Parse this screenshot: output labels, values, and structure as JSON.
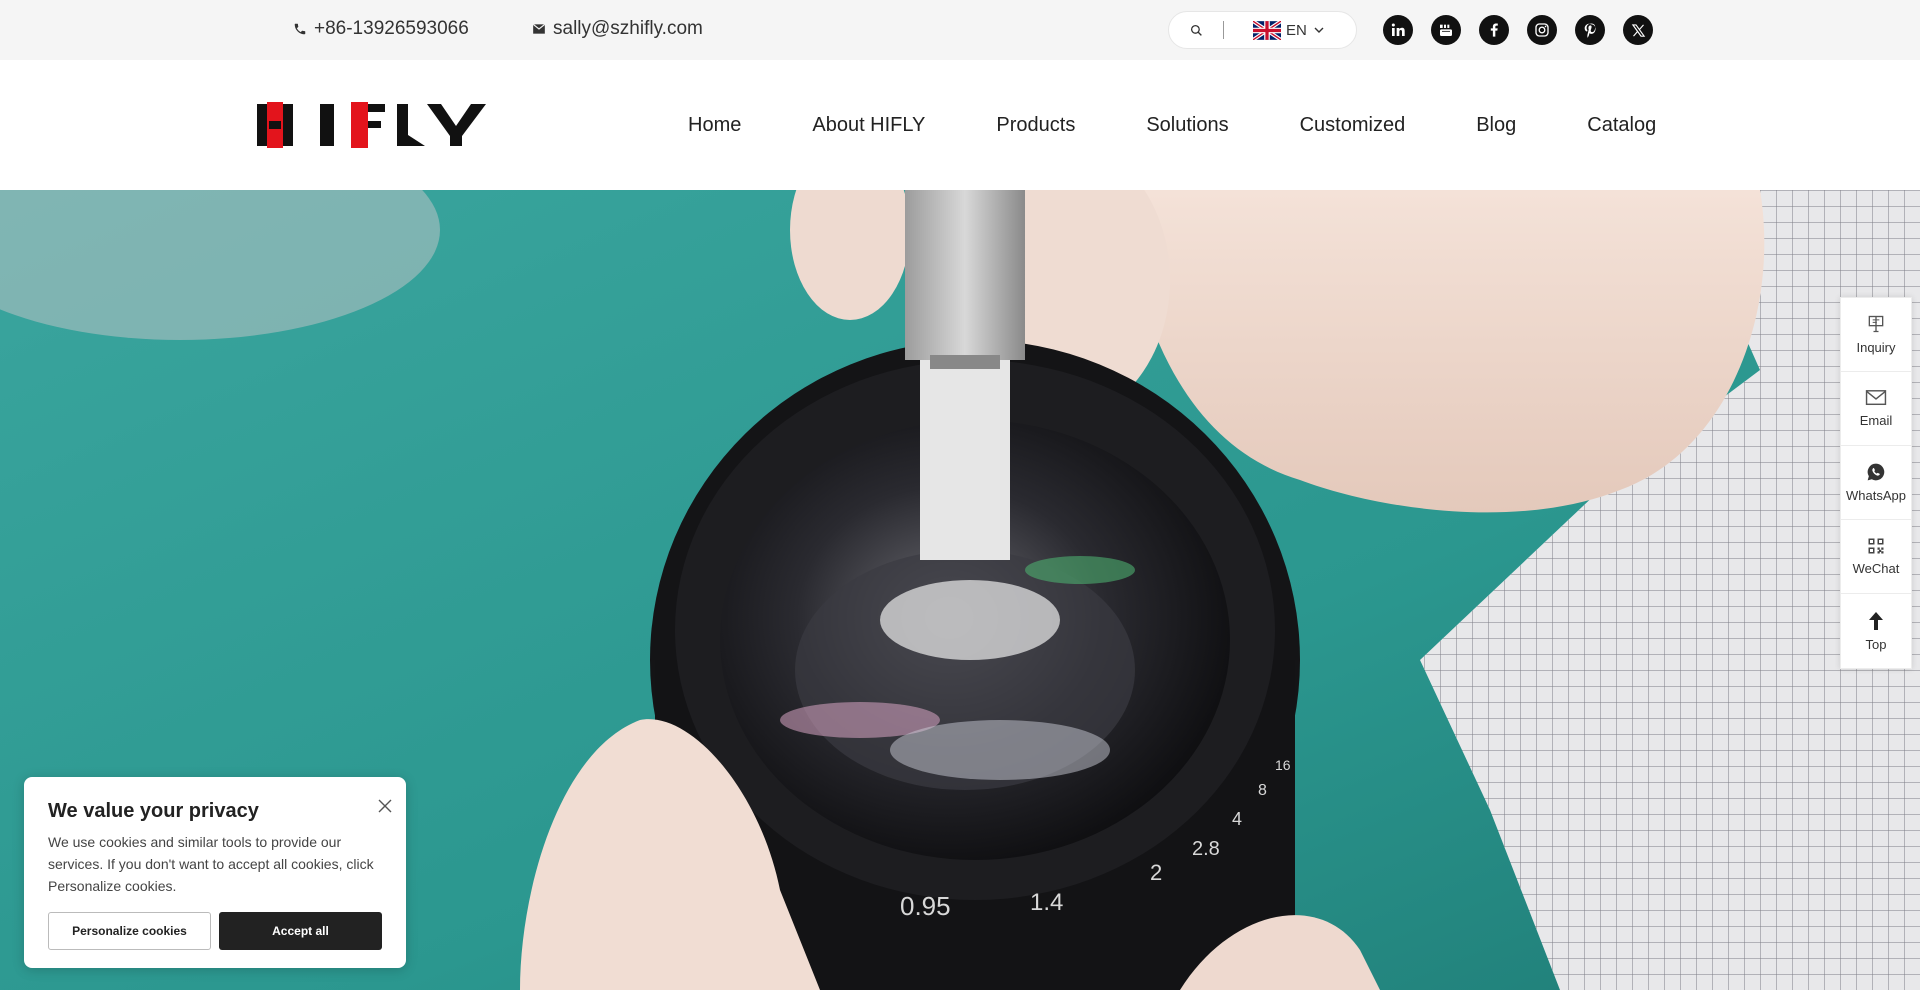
{
  "topbar": {
    "phone": "+86-13926593066",
    "email": "sally@szhifly.com",
    "language": "EN",
    "search_icon": "search-icon",
    "socials": [
      "linkedin-icon",
      "youtube-icon",
      "facebook-icon",
      "instagram-icon",
      "pinterest-icon",
      "x-icon"
    ]
  },
  "header": {
    "logo_text": "HIFLY",
    "nav": [
      "Home",
      "About HIFLY",
      "Products",
      "Solutions",
      "Customized",
      "Blog",
      "Catalog"
    ]
  },
  "sidebar": {
    "items": [
      {
        "label": "Inquiry",
        "icon": "inquiry-icon"
      },
      {
        "label": "Email",
        "icon": "email-icon"
      },
      {
        "label": "WhatsApp",
        "icon": "whatsapp-icon"
      },
      {
        "label": "WeChat",
        "icon": "qrcode-icon"
      },
      {
        "label": "Top",
        "icon": "arrow-up-icon"
      }
    ]
  },
  "cookie": {
    "title": "We value your privacy",
    "text": "We use cookies and similar tools to provide our services. If you don't want to accept all cookies, click Personalize cookies.",
    "personalize_label": "Personalize cookies",
    "accept_label": "Accept all"
  },
  "hero": {
    "lens_markings": [
      "0.95",
      "1.4",
      "2",
      "2.8",
      "4",
      "8",
      "16"
    ]
  },
  "colors": {
    "brand_red": "#e3141c",
    "hero_teal": "#2f9a92",
    "topbar_bg": "#f5f5f5"
  }
}
